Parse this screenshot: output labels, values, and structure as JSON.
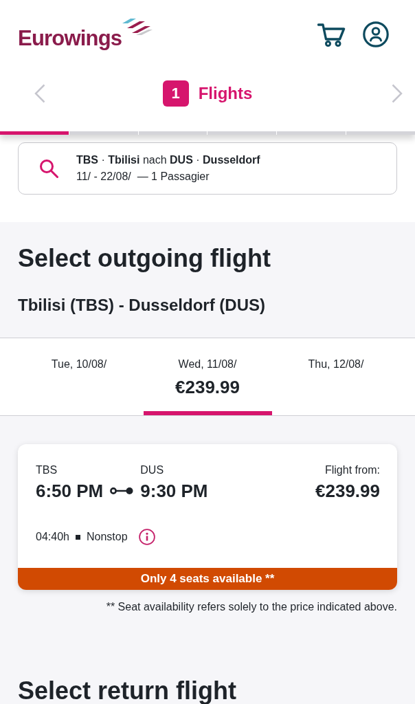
{
  "header": {
    "logo": "Eurowings"
  },
  "step_nav": {
    "number": "1",
    "label": "Flights",
    "progress": [
      {
        "done": true
      },
      {
        "done": false
      },
      {
        "done": false
      },
      {
        "done": false
      },
      {
        "done": false
      },
      {
        "done": false
      }
    ]
  },
  "search_summary": {
    "route": "**TBS** · **Tbilisi** nach **DUS** · **Dusseldorf**",
    "details": "11/ - 22/08/  — 1 Passagier"
  },
  "outgoing": {
    "title": "Select outgoing flight",
    "route": "Tbilisi (TBS) - Dusseldorf (DUS)",
    "dates": [
      {
        "label": "Tue, 10/08/",
        "selected": false
      },
      {
        "label": "Wed, 11/08/",
        "price": "€239.99",
        "selected": true
      },
      {
        "label": "Thu, 12/08/",
        "selected": false
      }
    ],
    "flights": [
      {
        "origin": "TBS",
        "departure": "6:50 PM",
        "destination": "DUS",
        "arrival": "9:30 PM",
        "price_label": "Flight from:",
        "price": "€239.99",
        "duration": "04:40h",
        "stops": "Nonstop",
        "availability": "Only 4 seats available **"
      }
    ],
    "footnote": "** Seat availability refers solely to the price indicated above."
  },
  "return": {
    "title": "Select return flight"
  }
}
